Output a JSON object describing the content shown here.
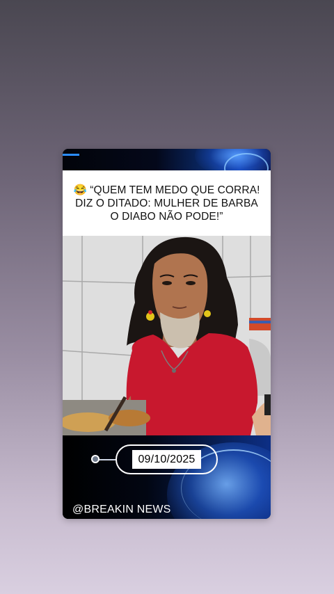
{
  "post": {
    "headline": "😂 “QUEM TEM MEDO QUE CORRA! DIZ O DITADO: MULHER DE BARBA O DIABO NÃO PODE!”",
    "date": "09/10/2025",
    "handle": "@BREAKIN NEWS",
    "story_progress": 0.08
  },
  "colors": {
    "accent_blue": "#2b8cff",
    "card_dark": "#050a14",
    "shirt_red": "#c8182e"
  },
  "icons": {
    "timeline_marker": "timeline-dot-icon"
  }
}
